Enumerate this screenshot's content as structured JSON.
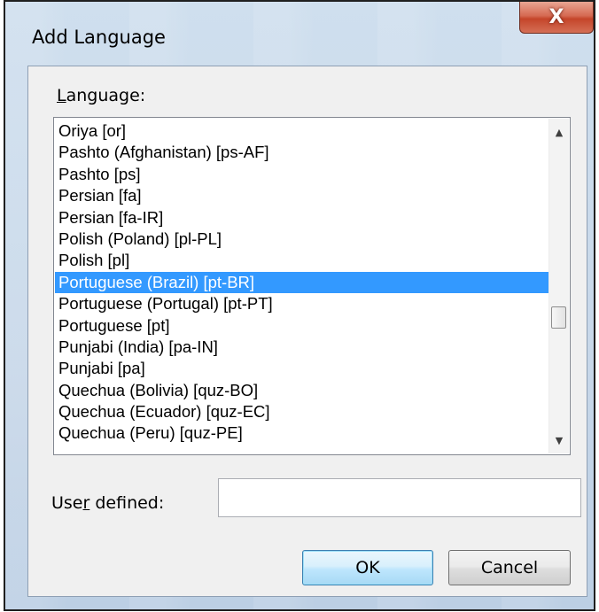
{
  "window": {
    "title": "Add Language",
    "close_glyph": "X"
  },
  "language_list": {
    "label_first": "L",
    "label_rest": "anguage:",
    "items": [
      "Oriya [or]",
      "Pashto (Afghanistan) [ps-AF]",
      "Pashto [ps]",
      "Persian [fa]",
      "Persian [fa-IR]",
      "Polish (Poland) [pl-PL]",
      "Polish [pl]",
      "Portuguese (Brazil) [pt-BR]",
      "Portuguese (Portugal) [pt-PT]",
      "Portuguese [pt]",
      "Punjabi (India) [pa-IN]",
      "Punjabi [pa]",
      "Quechua (Bolivia) [quz-BO]",
      "Quechua (Ecuador) [quz-EC]",
      "Quechua (Peru) [quz-PE]"
    ],
    "selected_index": 7,
    "scroll_up_icon": "▲",
    "scroll_down_icon": "▼"
  },
  "user_defined": {
    "label_before": "Use",
    "label_underlined": "r",
    "label_after": " defined:",
    "value": ""
  },
  "buttons": {
    "ok": "OK",
    "cancel": "Cancel"
  }
}
